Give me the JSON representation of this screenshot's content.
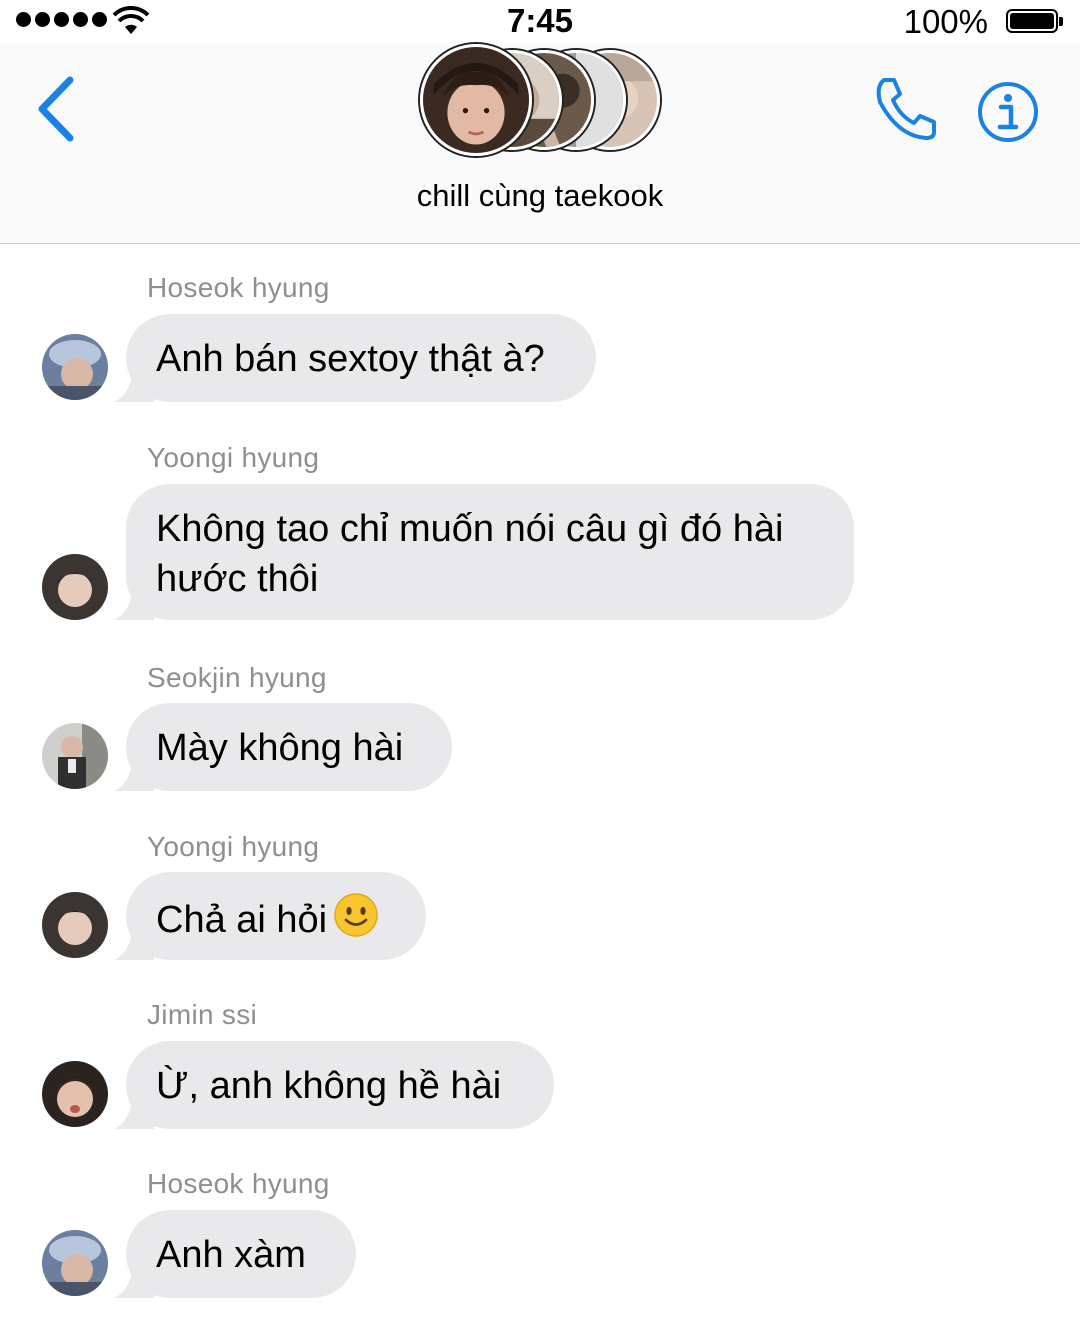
{
  "status_bar": {
    "time": "7:45",
    "battery_percent": "100%",
    "signal_bars": 5
  },
  "header": {
    "title": "chill cùng taekook",
    "back_icon": "chevron-left-icon",
    "call_icon": "phone-icon",
    "info_icon": "info-icon",
    "accent_color": "#1a82e2"
  },
  "messages": [
    {
      "sender": "Hoseok hyung",
      "text": "Anh bán sextoy thật à?"
    },
    {
      "sender": "Yoongi hyung",
      "text_line1": "Không tao chỉ muốn nói câu gì đó hài",
      "text_line2": "hước thôi"
    },
    {
      "sender": "Seokjin hyung",
      "text": "Mày không hài"
    },
    {
      "sender": "Yoongi hyung",
      "text": "Chả ai hỏi",
      "emoji": "slightly-smiling-face-icon"
    },
    {
      "sender": "Jimin ssi",
      "text": "Ừ, anh không hề hài"
    },
    {
      "sender": "Hoseok hyung",
      "text": "Anh xàm"
    }
  ]
}
